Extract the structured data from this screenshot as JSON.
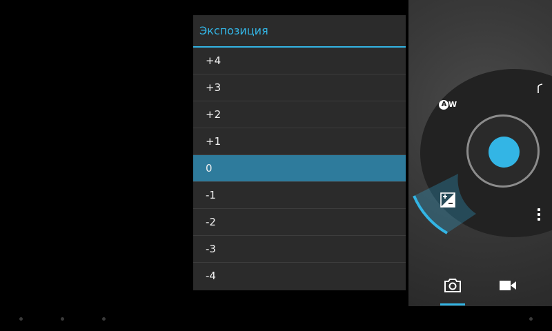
{
  "exposure_popup": {
    "title": "Экспозиция",
    "options": [
      "+4",
      "+3",
      "+2",
      "+1",
      "0",
      "-1",
      "-2",
      "-3",
      "-4"
    ],
    "selected": "0"
  },
  "controls": {
    "awb_icon_letter": "A",
    "awb_icon_suffix": "W",
    "accent_color": "#33b5e5",
    "icons": [
      "awb-icon",
      "flash-icon",
      "more-options-icon",
      "exposure-icon",
      "camera-mode-icon",
      "video-mode-icon"
    ]
  }
}
